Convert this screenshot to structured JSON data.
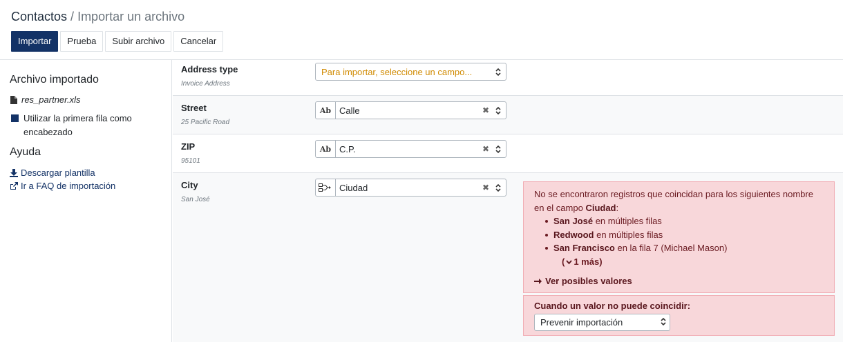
{
  "breadcrumb": {
    "root": "Contactos",
    "separator": " / ",
    "current": "Importar un archivo"
  },
  "toolbar": {
    "import_label": "Importar",
    "test_label": "Prueba",
    "upload_label": "Subir archivo",
    "cancel_label": "Cancelar"
  },
  "sidebar": {
    "imported_heading": "Archivo importado",
    "file_name": "res_partner.xls",
    "first_row_header_label": "Utilizar la primera fila como encabezado",
    "help_heading": "Ayuda",
    "download_template_label": "Descargar plantilla",
    "faq_label": "Ir a FAQ de importación"
  },
  "rows": [
    {
      "field": "Address type",
      "sample": "Invoice Address",
      "placeholder": "Para importar, seleccione un campo..."
    },
    {
      "field": "Street",
      "sample": "25 Pacific Road",
      "type_icon": "Ab",
      "value": "Calle"
    },
    {
      "field": "ZIP",
      "sample": "95101",
      "type_icon": "Ab",
      "value": "C.P."
    },
    {
      "field": "City",
      "sample": "San José",
      "type_icon": "relation-icon",
      "value": "Ciudad"
    }
  ],
  "alert": {
    "message_start": "No se encontraron registros que coincidan para los siguientes nombre en el campo ",
    "field_name": "Ciudad",
    "colon": ":",
    "items": [
      {
        "name": "San José",
        "detail": " en múltiples filas"
      },
      {
        "name": "Redwood",
        "detail": " en múltiples filas"
      },
      {
        "name": "San Francisco",
        "detail": " en la fila 7 (Michael Mason)"
      }
    ],
    "more_label": "1 más",
    "view_values_label": "Ver posibles valores"
  },
  "no_match": {
    "label": "Cuando un valor no puede coincidir:",
    "selected": "Prevenir importación"
  },
  "colors": {
    "primary": "#133266",
    "alert_bg": "#f8d7da",
    "alert_text": "#6a1a21",
    "placeholder": "#d08a00"
  }
}
